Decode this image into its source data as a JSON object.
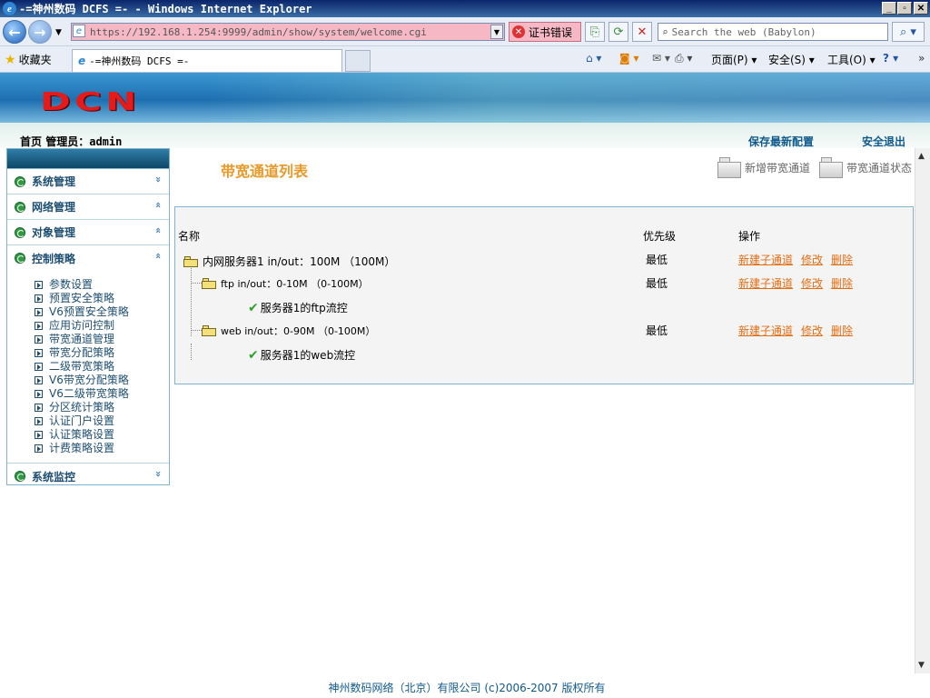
{
  "window": {
    "title": "-=神州数码 DCFS =- - Windows Internet Explorer"
  },
  "browser": {
    "address": "https://192.168.1.254:9999/admin/show/system/welcome.cgi",
    "cert_error": "证书错误",
    "search_placeholder": "Search the web (Babylon)",
    "favorites_label": "收藏夹",
    "tab_title": "-=神州数码 DCFS =-",
    "cmd_page": "页面(P)",
    "cmd_safety": "安全(S)",
    "cmd_tools": "工具(O)"
  },
  "header": {
    "logo": "DCN"
  },
  "topbar": {
    "home": "首页",
    "admin_label": "管理员：",
    "admin_name": "admin",
    "save_config": "保存最新配置",
    "logout": "安全退出"
  },
  "sidebar": {
    "sections": [
      {
        "label": "系统管理",
        "chevron": "»"
      },
      {
        "label": "网络管理",
        "chevron": "«"
      },
      {
        "label": "对象管理",
        "chevron": "«"
      },
      {
        "label": "控制策略",
        "chevron": "«"
      }
    ],
    "items": [
      "参数设置",
      "预置安全策略",
      "V6预置安全策略",
      "应用访问控制",
      "带宽通道管理",
      "带宽分配策略",
      "二级带宽策略",
      "V6带宽分配策略",
      "V6二级带宽策略",
      "分区统计策略",
      "认证门户设置",
      "认证策略设置",
      "计费策略设置"
    ],
    "last_section": {
      "label": "系统监控",
      "chevron": "»"
    }
  },
  "main": {
    "title": "带宽通道列表",
    "btn_new": "新增带宽通道",
    "btn_status": "带宽通道状态",
    "columns": {
      "name": "名称",
      "priority": "优先级",
      "ops": "操作"
    },
    "rows": [
      {
        "name": "内网服务器1 in/out：100M （100M）",
        "priority": "最低"
      },
      {
        "name": "ftp in/out：0-10M （0-100M）",
        "priority": "最低"
      },
      {
        "name": "服务器1的ftp流控"
      },
      {
        "name": "web in/out：0-90M （0-100M）",
        "priority": "最低"
      },
      {
        "name": "服务器1的web流控"
      }
    ],
    "op_new_sub": "新建子通道",
    "op_edit": "修改",
    "op_delete": "删除"
  },
  "footer": {
    "text": "神州数码网络（北京）有限公司 (c)2006-2007 版权所有"
  }
}
